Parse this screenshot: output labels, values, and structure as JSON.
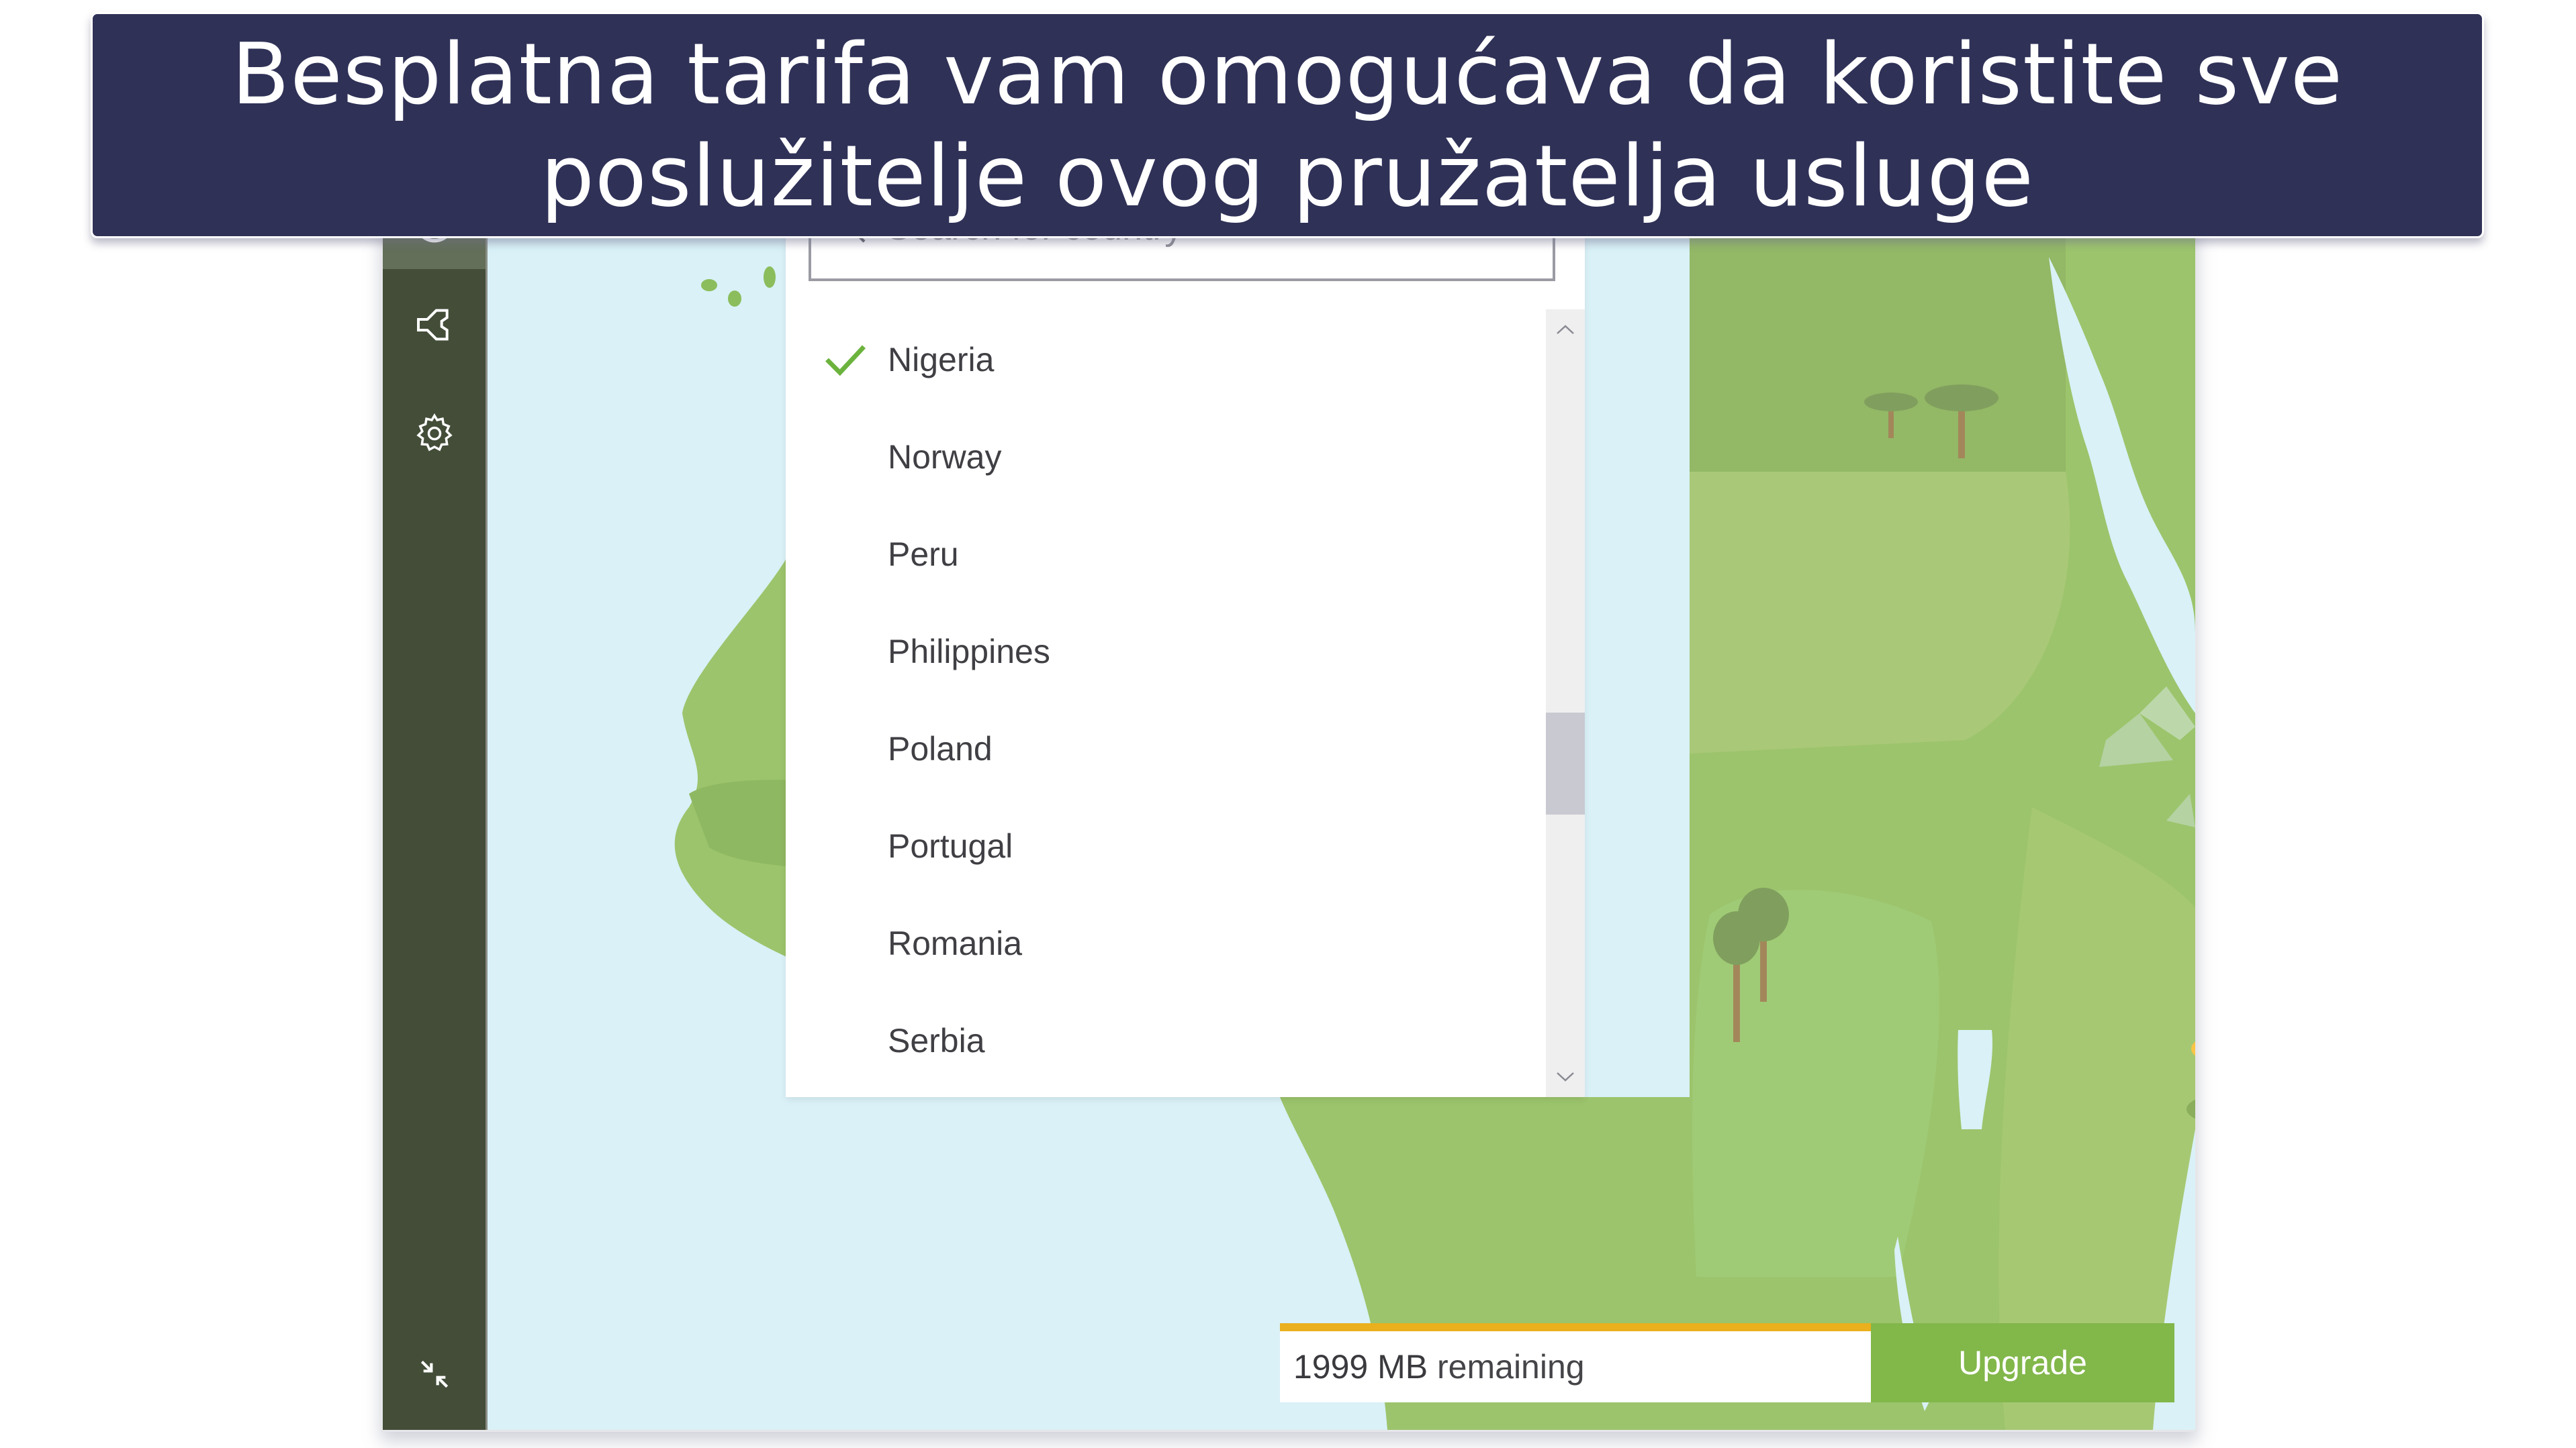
{
  "banner": {
    "line1": "Besplatna tarifa vam omogućava da koristite sve",
    "line2": "poslužitelje ovog pružatelja usluge"
  },
  "sidebar": {
    "items": [
      {
        "icon": "globe-icon",
        "active": true
      },
      {
        "icon": "split-tunnel-icon",
        "active": false
      },
      {
        "icon": "gear-icon",
        "active": false
      }
    ],
    "bottom_icon": "collapse-icon"
  },
  "dropdown": {
    "search_placeholder": "Search for country",
    "countries": [
      {
        "name": "Nigeria",
        "selected": true
      },
      {
        "name": "Norway",
        "selected": false
      },
      {
        "name": "Peru",
        "selected": false
      },
      {
        "name": "Philippines",
        "selected": false
      },
      {
        "name": "Poland",
        "selected": false
      },
      {
        "name": "Portugal",
        "selected": false
      },
      {
        "name": "Romania",
        "selected": false
      },
      {
        "name": "Serbia",
        "selected": false
      }
    ],
    "scroll_position_fraction": 0.6
  },
  "data_bar": {
    "amount": "1999 MB",
    "suffix": "remaining",
    "upgrade_label": "Upgrade"
  },
  "colors": {
    "banner_bg": "#2f3157",
    "sidebar_bg": "#434d38",
    "sidebar_active": "#636f59",
    "ocean": "#d9f1f7",
    "land": "#9cc46c",
    "accent_green": "#82b74a",
    "data_bar_accent": "#eab01e",
    "check": "#6cb33e"
  }
}
